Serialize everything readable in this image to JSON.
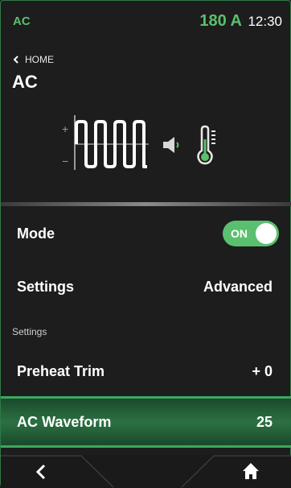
{
  "status": {
    "mode": "AC",
    "amperage": "180 A",
    "time": "12:30"
  },
  "nav": {
    "back_label": "HOME",
    "title": "AC"
  },
  "graphic": {
    "plus": "+",
    "minus": "−"
  },
  "rows": {
    "mode": {
      "label": "Mode",
      "toggle_label": "ON",
      "state": true
    },
    "settings": {
      "label": "Settings",
      "value": "Advanced"
    }
  },
  "section": {
    "header": "Settings"
  },
  "items": [
    {
      "label": "Preheat Trim",
      "value": "+ 0"
    },
    {
      "label": "AC Waveform",
      "value": "25"
    }
  ],
  "colors": {
    "accent": "#5ac06f",
    "selected_bg": "#2c7042",
    "background": "#1d1d1d"
  },
  "icons": {
    "back": "chevron-left-icon",
    "home": "home-icon",
    "speaker": "speaker-icon",
    "temperature": "thermometer-icon"
  }
}
